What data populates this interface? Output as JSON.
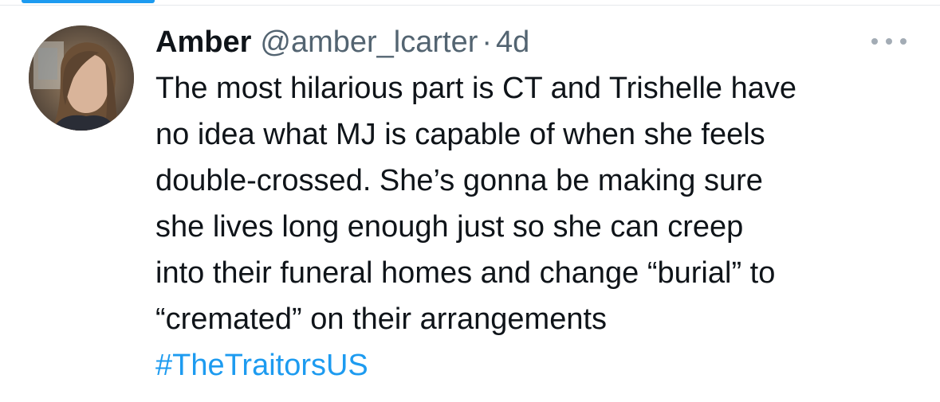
{
  "colors": {
    "accent": "#1d9bf0",
    "text_primary": "#0f1419",
    "text_secondary": "#536471"
  },
  "tweet": {
    "author": {
      "display_name": "Amber",
      "handle": "@amber_lcarter",
      "avatar": "profile-photo"
    },
    "separator": "·",
    "timestamp": "4d",
    "more_icon": "more-horizontal-icon",
    "text_lines": [
      "The most hilarious part is CT and Trishelle have",
      "no idea what MJ is capable of when she feels",
      "double-crossed. She’s gonna be making sure",
      "she lives long enough just so she can creep",
      "into their funeral homes and change “burial” to",
      "“cremated” on their arrangements"
    ],
    "hashtag": "#TheTraitorsUS"
  }
}
